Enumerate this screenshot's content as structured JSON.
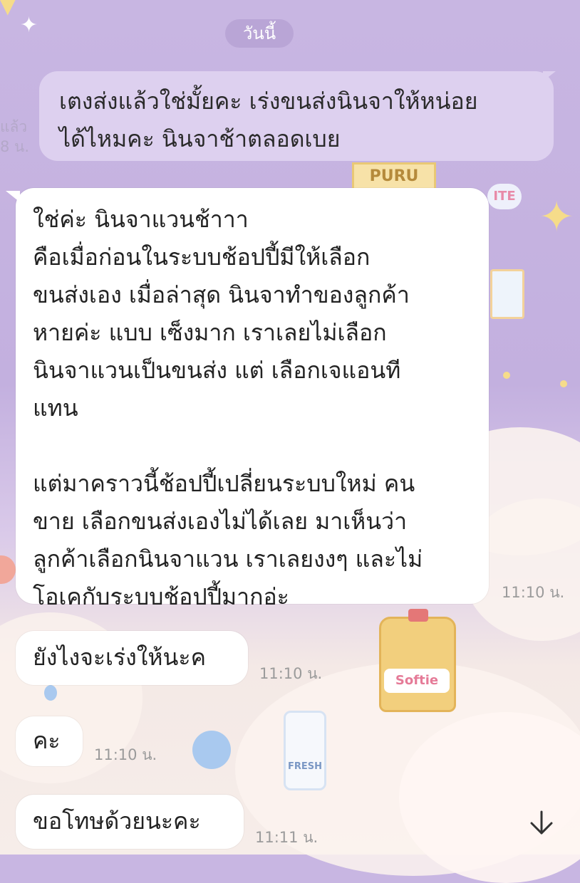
{
  "date_separator": "วันนี้",
  "side_partial": {
    "read": "แล้ว",
    "time": "8 น."
  },
  "sent_message": {
    "lines": [
      "เตงส่งแล้วใช่มั้ยคะ เร่งขนส่งนินจาให้หน่อย",
      "ได้ไหมคะ นินจาช้าตลอดเบย"
    ]
  },
  "received_messages": [
    {
      "lines": [
        "ใช่ค่ะ นินจาแวนช้าาา",
        "คือเมื่อก่อนในระบบช้อปปี้มีให้เลือก",
        "ขนส่งเอง เมื่อล่าสุด นินจาทำของลูกค้า",
        "หายค่ะ แบบ เซ็งมาก เราเลยไม่เลือก",
        "นินจาแวนเป็นขนส่ง แต่ เลือกเจแอนที",
        "แทน"
      ],
      "lines2": [
        "แต่มาคราวนี้ช้อปปี้เปลี่ยนระบบใหม่ คน",
        "ขาย เลือกขนส่งเองไม่ได้เลย มาเห็นว่า",
        "ลูกค้าเลือกนินจาแวน เราเลยงงๆ และไม่",
        "โอเคกับระบบช้อปปี้มากอ่ะ"
      ],
      "time": "11:10 น."
    },
    {
      "text": "ยังไงจะเร่งให้นะค",
      "time": "11:10 น."
    },
    {
      "text": "คะ",
      "time": "11:10 น."
    },
    {
      "text": "ขอโทษด้วยนะคะ",
      "time": "11:11 น."
    }
  ],
  "background_labels": {
    "puru": "PURU",
    "ite": "ITE",
    "softie": "Softie",
    "fresh": "FRESH"
  },
  "icons": {
    "scroll_down": "arrow-down-icon"
  },
  "colors": {
    "sent_bubble": "#ddd0ef",
    "received_bubble": "#ffffff",
    "background_top": "#c8b6e2"
  }
}
